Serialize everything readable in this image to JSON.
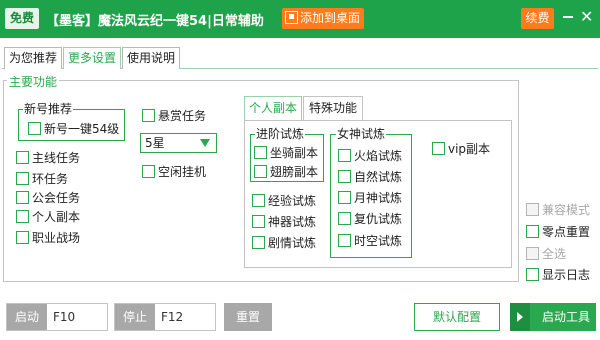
{
  "titlebar": {
    "free_badge": "免费",
    "title": "【墨客】魔法风云纪一键54|日常辅助",
    "add_to_desktop": "添加到桌面",
    "renew": "续费",
    "minimize_icon": "minimize-icon",
    "close_icon": "close-icon",
    "close_glyph": "✕",
    "accent_color": "#1fa34a",
    "orange_color": "#ff7b1c"
  },
  "top_tabs": [
    "为您推荐",
    "更多设置",
    "使用说明"
  ],
  "top_tabs_selected": "更多设置",
  "main": {
    "title": "主要功能",
    "newbie_group": {
      "label": "新号推荐",
      "item": "新号一键54级"
    },
    "tasks": [
      "主线任务",
      "环任务",
      "公会任务",
      "个人副本",
      "职业战场"
    ],
    "bounty": "悬赏任务",
    "star_select": {
      "value": "5星"
    },
    "idle": "空闲挂机"
  },
  "inner_tabs": [
    "个人副本",
    "特殊功能"
  ],
  "inner_tabs_selected": "个人副本",
  "personal_dungeon": {
    "advanced_group": {
      "label": "进阶试炼",
      "items": [
        "坐骑副本",
        "翅膀副本"
      ]
    },
    "extra": [
      "经验试炼",
      "神器试炼",
      "剧情试炼"
    ],
    "goddess_group": {
      "label": "女神试炼",
      "items": [
        "火焰试炼",
        "自然试炼",
        "月神试炼",
        "复仇试炼",
        "时空试炼"
      ]
    },
    "vip": "vip副本"
  },
  "right_options": [
    "兼容模式",
    "零点重置",
    "全选",
    "显示日志"
  ],
  "right_options_disabled": [
    "兼容模式",
    "全选"
  ],
  "bottom": {
    "start_label": "启动",
    "start_key": "F10",
    "stop_label": "停止",
    "stop_key": "F12",
    "reset": "重置",
    "default_config": "默认配置",
    "launch_tool": "启动工具"
  }
}
